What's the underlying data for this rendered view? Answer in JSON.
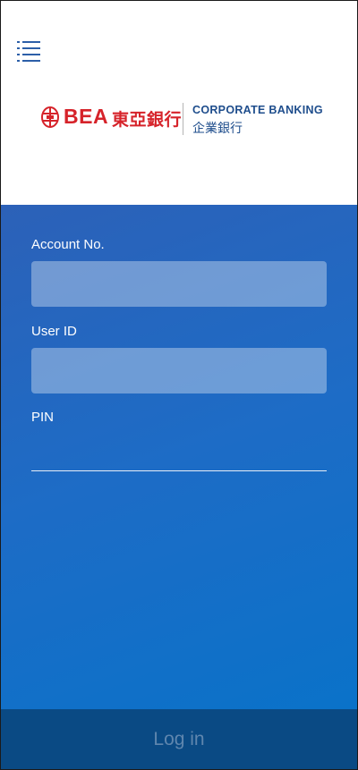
{
  "header": {
    "menu_icon": "hamburger-list-icon",
    "logo": {
      "bank_abbrev": "BEA",
      "bank_chinese": "東亞銀行",
      "division_en": "CORPORATE BANKING",
      "division_cn": "企業銀行",
      "brand_color": "#d6232a",
      "division_color": "#1e4d8c"
    }
  },
  "form": {
    "account_label": "Account No.",
    "account_value": "",
    "userid_label": "User ID",
    "userid_value": "",
    "pin_label": "PIN",
    "pin_value": ""
  },
  "footer": {
    "login_label": "Log in",
    "login_bg": "#0a4a84"
  },
  "colors": {
    "panel_gradient_start": "#2c61b8",
    "panel_gradient_end": "#0a72c9",
    "accent": "#2c5fa8"
  }
}
